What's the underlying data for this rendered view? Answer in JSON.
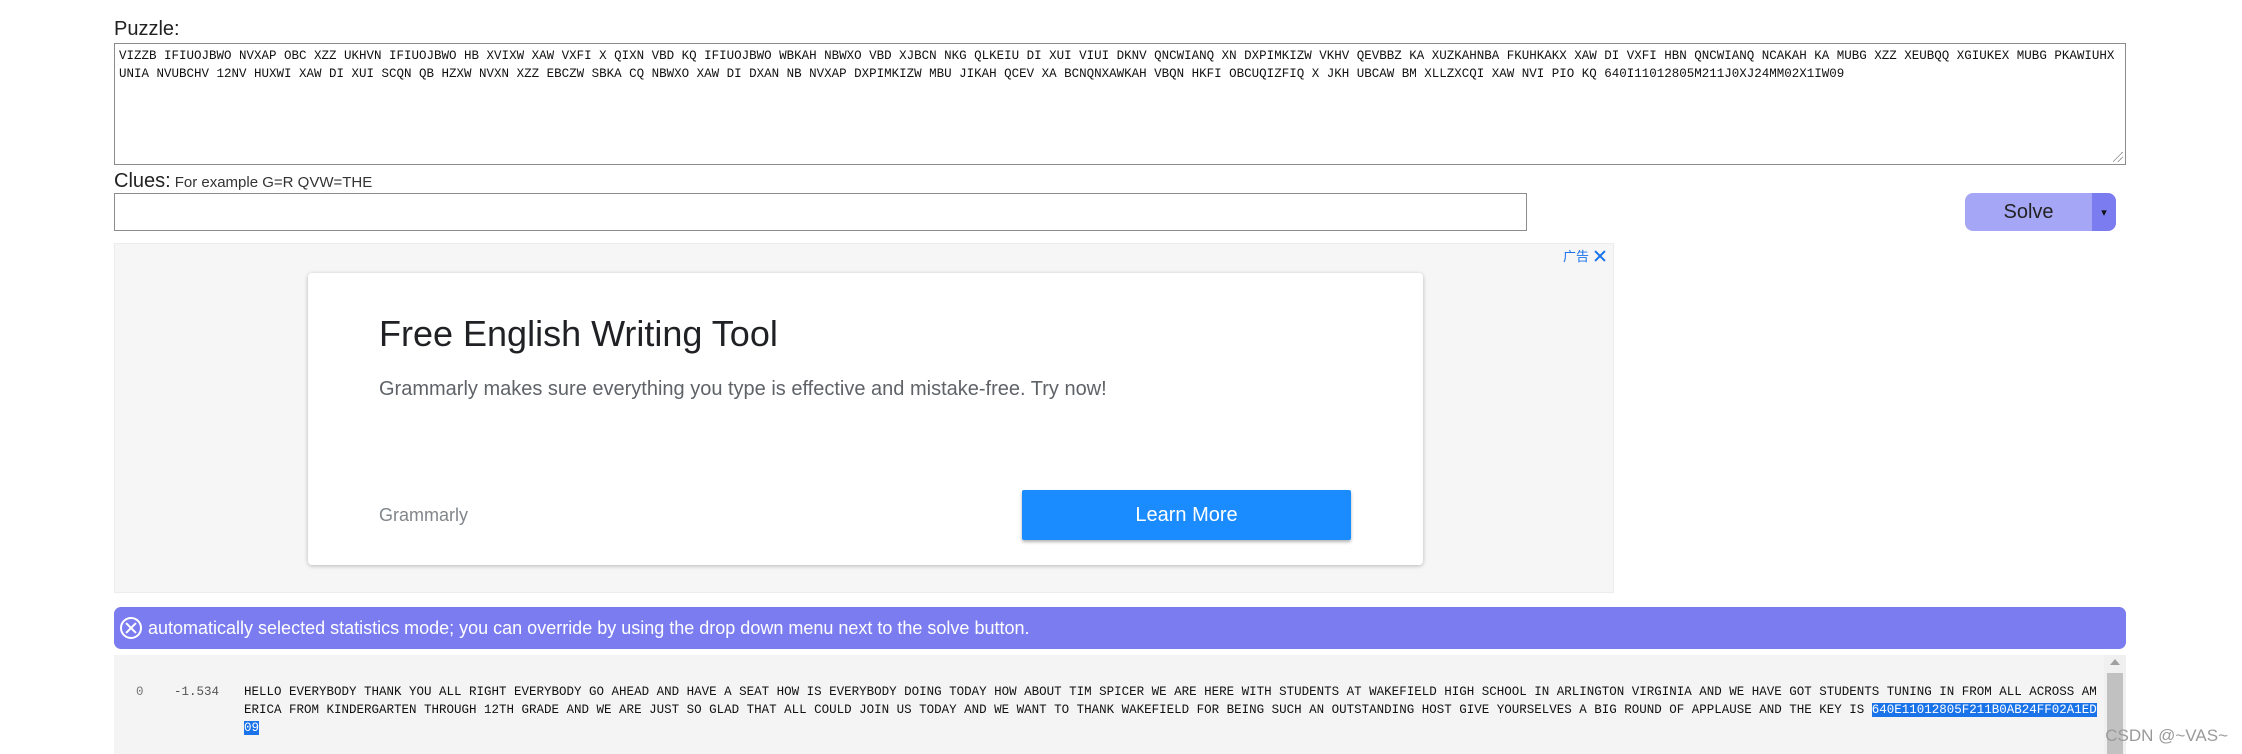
{
  "puzzle": {
    "label": "Puzzle:",
    "text": "VIZZB IFIUOJBWO NVXAP OBC XZZ UKHVN IFIUOJBWO HB XVIXW XAW VXFI X QIXN VBD KQ IFIUOJBWO WBKAH NBWXO VBD XJBCN NKG QLKEIU DI XUI VIUI DKNV QNCWIANQ XN DXPIMKIZW VKHV QEVBBZ KA XUZKAHNBA FKUHKAKX XAW DI VXFI HBN QNCWIANQ NCAKAH KA MUBG XZZ XEUBQQ XGIUKEX MUBG PKAWIUHXUNIA NVUBCHV 12NV HUXWI XAW DI XUI SCQN QB HZXW NVXN XZZ EBCZW SBKA CQ NBWXO XAW DI DXAN NB NVXAP DXPIMKIZW MBU JIKAH QCEV XA BCNQNXAWKAH VBQN HKFI OBCUQIZFIQ X JKH UBCAW BM XLLZXCQI XAW NVI PIO KQ 640I11012805M211J0XJ24MM02X1IW09"
  },
  "clues": {
    "label": "Clues:",
    "hint": "For example G=R QVW=THE",
    "value": "",
    "placeholder": ""
  },
  "solve": {
    "label": "Solve",
    "dropdown_glyph": "▾"
  },
  "ad": {
    "badge_text": "广告",
    "title": "Free English Writing Tool",
    "description": "Grammarly makes sure everything you type is effective and mistake-free. Try now!",
    "advertiser": "Grammarly",
    "cta_label": "Learn More"
  },
  "notice": {
    "text": "automatically selected statistics mode; you can override by using the drop down menu next to the solve button."
  },
  "results": [
    {
      "index": "0",
      "score": "-1.534",
      "text": "HELLO EVERYBODY THANK YOU ALL RIGHT EVERYBODY GO AHEAD AND HAVE A SEAT HOW IS EVERYBODY DOING TODAY HOW ABOUT TIM SPICER WE ARE HERE WITH STUDENTS AT WAKEFIELD HIGH SCHOOL IN ARLINGTON VIRGINIA AND WE HAVE GOT STUDENTS TUNING IN FROM ALL ACROSS AMERICA FROM KINDERGARTEN THROUGH 12TH GRADE AND WE ARE JUST SO GLAD THAT ALL COULD JOIN US TODAY AND WE WANT TO THANK WAKEFIELD FOR BEING SUCH AN OUTSTANDING HOST GIVE YOURSELVES A BIG ROUND OF APPLAUSE AND THE KEY IS ",
      "highlight": "640E11012805F211B0AB24FF02A1ED09"
    }
  ],
  "watermark": "CSDN @~VAS~"
}
